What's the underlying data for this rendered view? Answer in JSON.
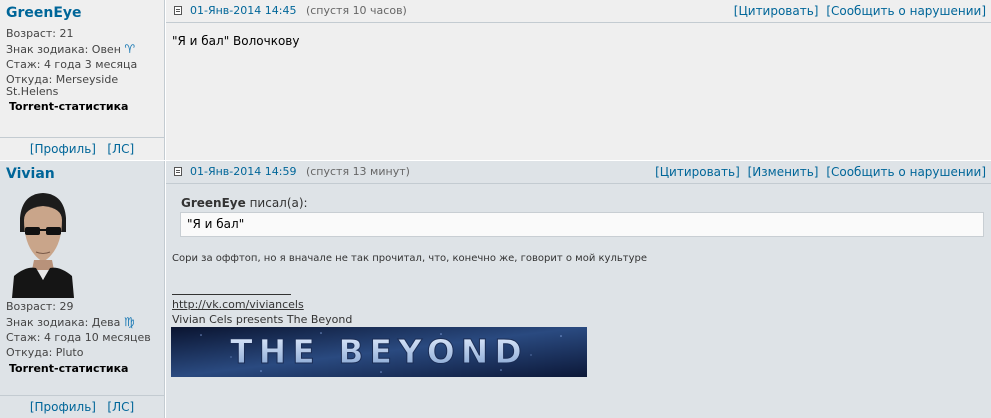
{
  "post1": {
    "nick": "GreenEye",
    "age": "Возраст: 21",
    "zodiac": "Знак зодиака: Овен",
    "zodiac_symbol": "♈",
    "tenure": "Стаж: 4 года 3 месяца",
    "from_label": "Откуда: Merseyside",
    "from_line2": "St.Helens",
    "torrent": "Torrent-статистика",
    "profile": "[Профиль]",
    "pm": "[ЛС]",
    "date": "01-Янв-2014 14:45",
    "since": "(спустя 10 часов)",
    "quote": "[Цитировать]",
    "report": "[Сообщить о нарушении]",
    "body": "\"Я и бал\" Волочкову"
  },
  "post2": {
    "nick": "Vivian",
    "age": "Возраст: 29",
    "zodiac": "Знак зодиака: Дева",
    "zodiac_symbol": "♍",
    "tenure": "Стаж: 4 года 10 месяцев",
    "from_label": "Откуда: Pluto",
    "torrent": "Torrent-статистика",
    "profile": "[Профиль]",
    "pm": "[ЛС]",
    "date": "01-Янв-2014 14:59",
    "since": "(спустя 13 минут)",
    "quote": "[Цитировать]",
    "edit": "[Изменить]",
    "report": "[Сообщить о нарушении]",
    "quote_author": "GreenEye",
    "quote_suffix": "писал(а):",
    "quote_text": "\"Я и бал\"",
    "body": "Сори за оффтоп, но я вначале не так прочитал, что, конечно же, говорит о мой культуре",
    "sig_link": "http://vk.com/viviancels",
    "sig_text": "Vivian Cels presents The Beyond",
    "banner_text": "THE BEYOND"
  },
  "colors": {
    "link": "#006699",
    "bg_post1": "#efefef",
    "bg_post2": "#dee3e7",
    "zodiac": "#1e7bb5"
  }
}
